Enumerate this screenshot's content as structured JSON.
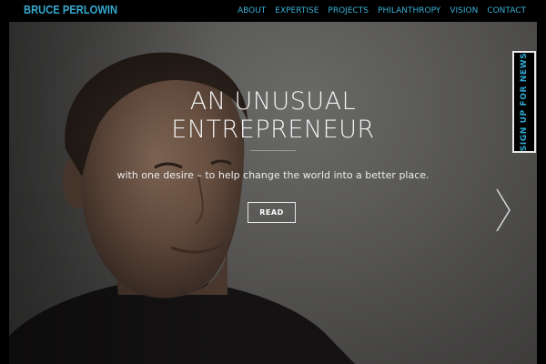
{
  "header": {
    "brand": "BRUCE PERLOWIN",
    "nav": [
      "ABOUT",
      "EXPERTISE",
      "PROJECTS",
      "PHILANTHROPY",
      "VISION",
      "CONTACT"
    ]
  },
  "hero": {
    "headline_line1": "AN UNUSUAL",
    "headline_line2": "ENTREPRENEUR",
    "tagline": "with one desire – to help change the world into a better place.",
    "button_label": "READ"
  },
  "signup_tab": {
    "label": "SIGN UP FOR NEWS"
  },
  "icons": {
    "next": "chevron-right-icon",
    "portrait": "portrait-photo"
  },
  "colors": {
    "brand": "#35a9cf",
    "nav": "#3bb0d6",
    "signup_text": "#2fa8d2"
  }
}
